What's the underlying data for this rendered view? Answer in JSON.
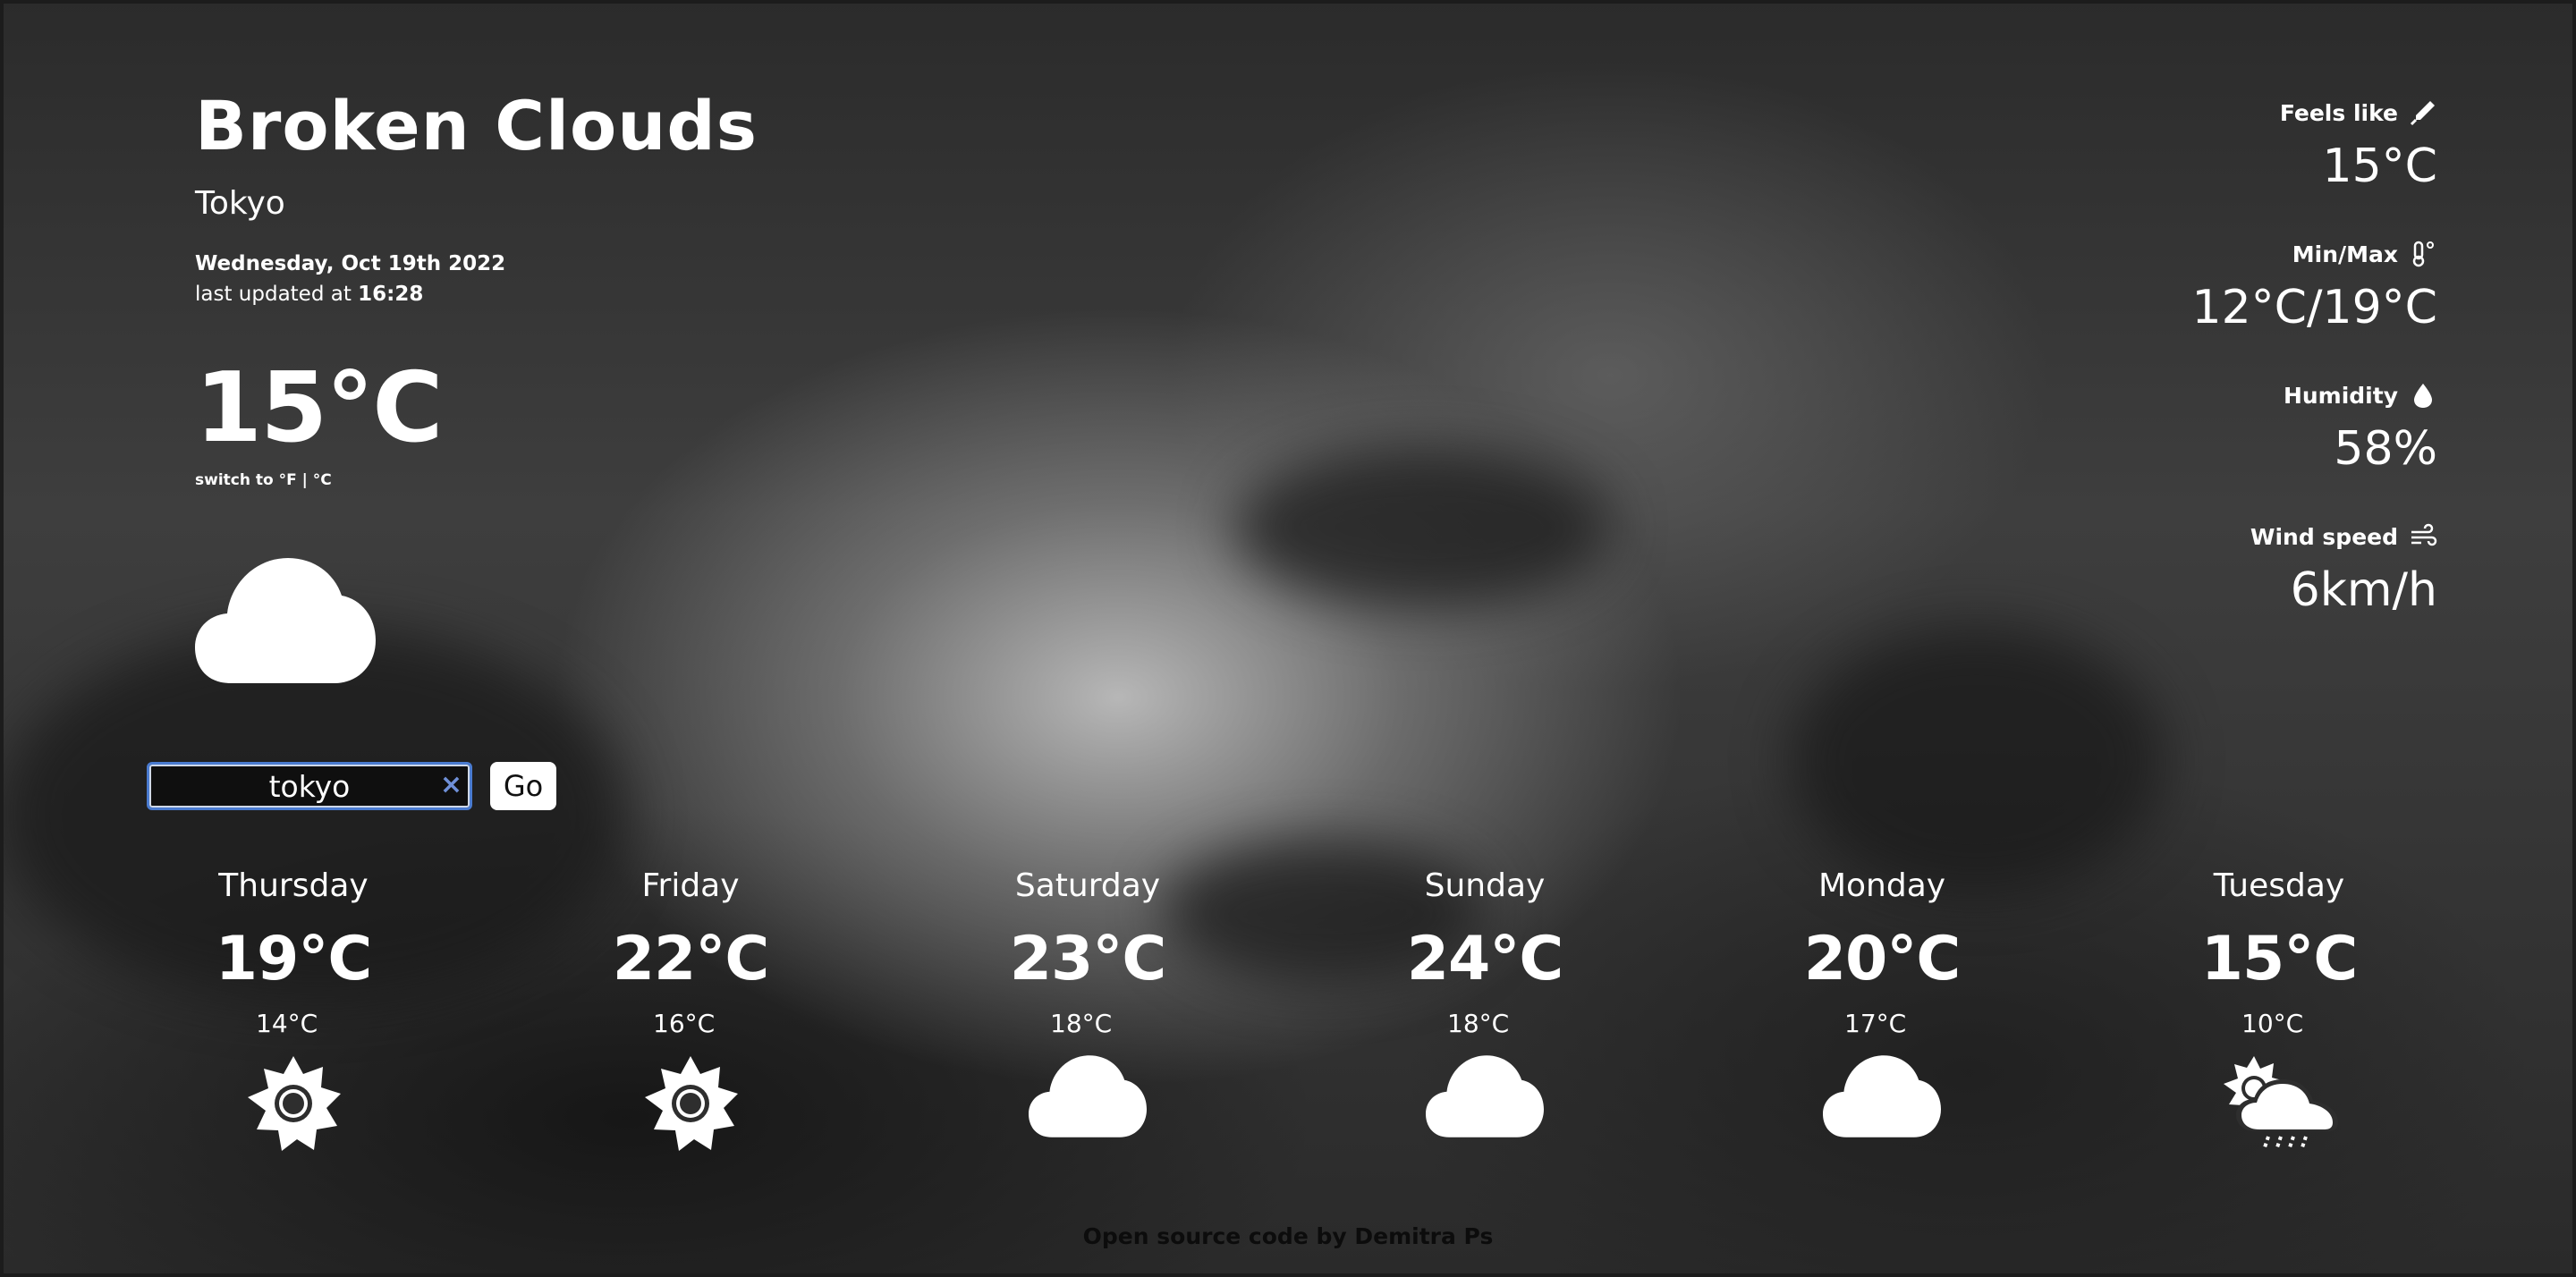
{
  "header": {
    "condition": "Broken Clouds",
    "city": "Tokyo",
    "date": "Wednesday, Oct 19th 2022",
    "updated_prefix": "last updated at ",
    "updated_time": "16:28",
    "temperature": "15°C",
    "switch_prefix": "switch to ",
    "switch_f": "°F",
    "switch_sep": " | ",
    "switch_c": "°C",
    "icon": "cloud-icon"
  },
  "search": {
    "value": "tokyo",
    "clear_label": "×",
    "button_label": "Go"
  },
  "stats": [
    {
      "label": "Feels like",
      "value": "15°C",
      "icon": "thermometer-icon"
    },
    {
      "label": "Min/Max",
      "value": "12°C/19°C",
      "icon": "temperature-range-icon"
    },
    {
      "label": "Humidity",
      "value": "58%",
      "icon": "droplet-icon"
    },
    {
      "label": "Wind speed",
      "value": "6km/h",
      "icon": "wind-icon"
    }
  ],
  "forecast": [
    {
      "day": "Thursday",
      "max": "19°C",
      "min": "14°C",
      "icon": "sun-icon"
    },
    {
      "day": "Friday",
      "max": "22°C",
      "min": "16°C",
      "icon": "sun-icon"
    },
    {
      "day": "Saturday",
      "max": "23°C",
      "min": "18°C",
      "icon": "cloud-icon"
    },
    {
      "day": "Sunday",
      "max": "24°C",
      "min": "18°C",
      "icon": "cloud-icon"
    },
    {
      "day": "Monday",
      "max": "20°C",
      "min": "17°C",
      "icon": "cloud-icon"
    },
    {
      "day": "Tuesday",
      "max": "15°C",
      "min": "10°C",
      "icon": "sun-rain-cloud-icon"
    }
  ],
  "footer": {
    "link_text": "Open source code",
    "suffix": " by Demitra Ps"
  },
  "colors": {
    "accent": "#4a7bd0",
    "text": "#ffffff",
    "footer_text": "#0c0c0c"
  }
}
